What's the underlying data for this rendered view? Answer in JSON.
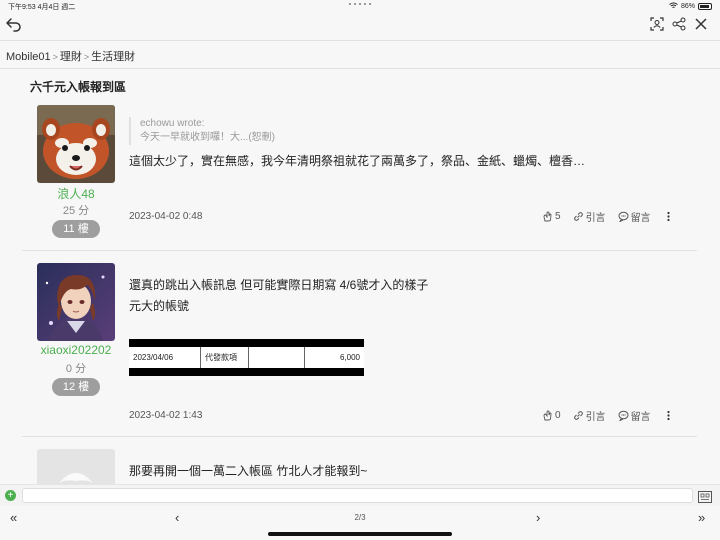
{
  "status_bar": {
    "time": "下午9:53",
    "date": "4月4日 週二",
    "battery": "86%"
  },
  "breadcrumb": {
    "items": [
      "Mobile01",
      "理財",
      "生活理財"
    ]
  },
  "thread": {
    "title": "六千元入帳報到區"
  },
  "posts": [
    {
      "username": "浪人48",
      "score": "25 分",
      "floor": "11 樓",
      "quote_author": "echowu wrote:",
      "quote_text": "今天一早就收到囉！大...(恕刪)",
      "body_lines": [
        "這個太少了，實在無感，我今年清明祭祖就花了兩萬多了，祭品、金紙、蠟燭、檀香…"
      ],
      "time": "2023-04-02 0:48",
      "likes": "5",
      "quote_label": "引言",
      "comment_label": "留言"
    },
    {
      "username": "xiaoxi202202",
      "score": "0 分",
      "floor": "12 樓",
      "body_lines": [
        "還真的跳出入帳訊息 但可能實際日期寫 4/6號才入的樣子",
        "元大的帳號"
      ],
      "image_cells": [
        "2023/04/06",
        "代發款項",
        "",
        "6,000"
      ],
      "time": "2023-04-02 1:43",
      "likes": "0",
      "quote_label": "引言",
      "comment_label": "留言"
    },
    {
      "body_lines": [
        "那要再開一個一萬二入帳區 竹北人才能報到~"
      ]
    }
  ],
  "pager": {
    "first": "«",
    "prev": "‹",
    "page": "2/3",
    "next": "›",
    "last": "»"
  },
  "colors": {
    "accent": "#4caf50",
    "floor_badge": "#9e9e9e"
  }
}
